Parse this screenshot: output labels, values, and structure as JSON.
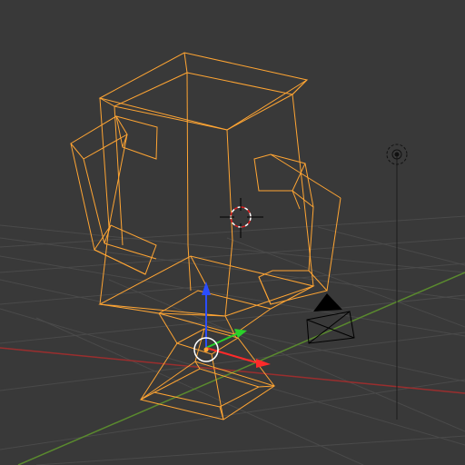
{
  "viewport": {
    "view": "3D Viewport",
    "shading": "wireframe",
    "grid": true,
    "axes_shown": [
      "X",
      "Y"
    ]
  },
  "colors": {
    "background": "#393939",
    "grid": "#4a4a4a",
    "selected_wire": "#ffa533",
    "x_axis": "#9a2e2e",
    "y_axis": "#5a8a2e",
    "gizmo_x": "#ff2a2a",
    "gizmo_y": "#2ad02a",
    "gizmo_z": "#2a4dff",
    "object_wire": "#000000"
  },
  "objects": [
    {
      "name": "vase-mesh",
      "type": "mesh",
      "selected": true
    },
    {
      "name": "camera",
      "type": "camera",
      "selected": false
    },
    {
      "name": "lamp",
      "type": "lamp",
      "selected": false
    }
  ],
  "icons": {
    "cursor": "3d-cursor-icon",
    "transform": "transform-gizmo-icon",
    "lamp": "lamp-icon",
    "camera": "camera-icon"
  }
}
